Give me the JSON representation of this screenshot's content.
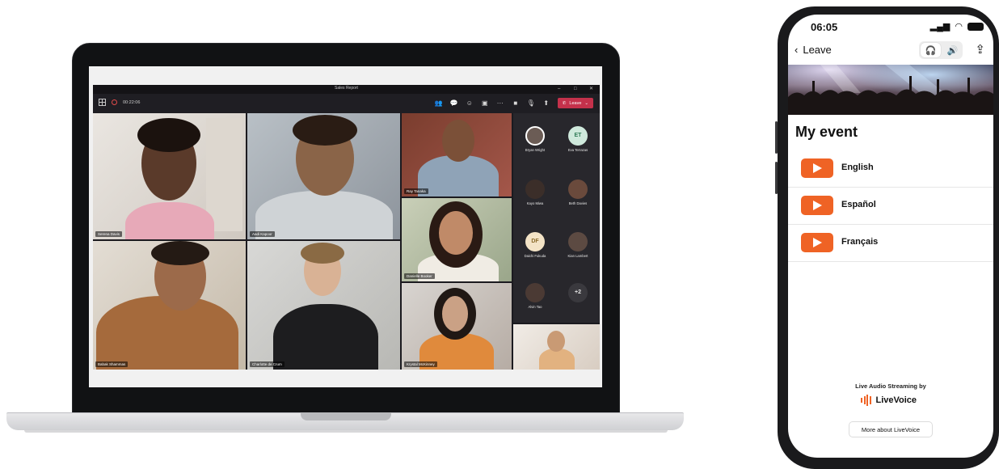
{
  "laptop": {
    "window_title": "Sales Report",
    "timer": "00:22:06",
    "leave_label": "Leave",
    "participants": [
      {
        "name": "Serena Davis"
      },
      {
        "name": "Aadi Kapoor"
      },
      {
        "name": "Ray Tanaka"
      },
      {
        "name": "Danielle Booker"
      },
      {
        "name": "Babak Shammas"
      },
      {
        "name": "Charlotte de Crum"
      },
      {
        "name": "Krystal McKinney"
      }
    ],
    "roster": [
      {
        "name": "Bryan Wright",
        "initials": ""
      },
      {
        "name": "Eva Terrazas",
        "initials": "ET"
      },
      {
        "name": "Kayo Miwa",
        "initials": ""
      },
      {
        "name": "Beth Davies",
        "initials": ""
      },
      {
        "name": "Daichi Fukuda",
        "initials": "DF"
      },
      {
        "name": "Kian Lambert",
        "initials": ""
      },
      {
        "name": "Alvin Tao",
        "initials": ""
      },
      {
        "name": "",
        "initials": "+2"
      }
    ]
  },
  "phone": {
    "status_time": "06:05",
    "back_label": "Leave",
    "event_title": "My event",
    "languages": [
      "English",
      "Español",
      "Français"
    ],
    "powered_by": "Live Audio Streaming by",
    "brand": "LiveVoice",
    "more_button": "More about LiveVoice",
    "accent_color": "#ef6325"
  }
}
